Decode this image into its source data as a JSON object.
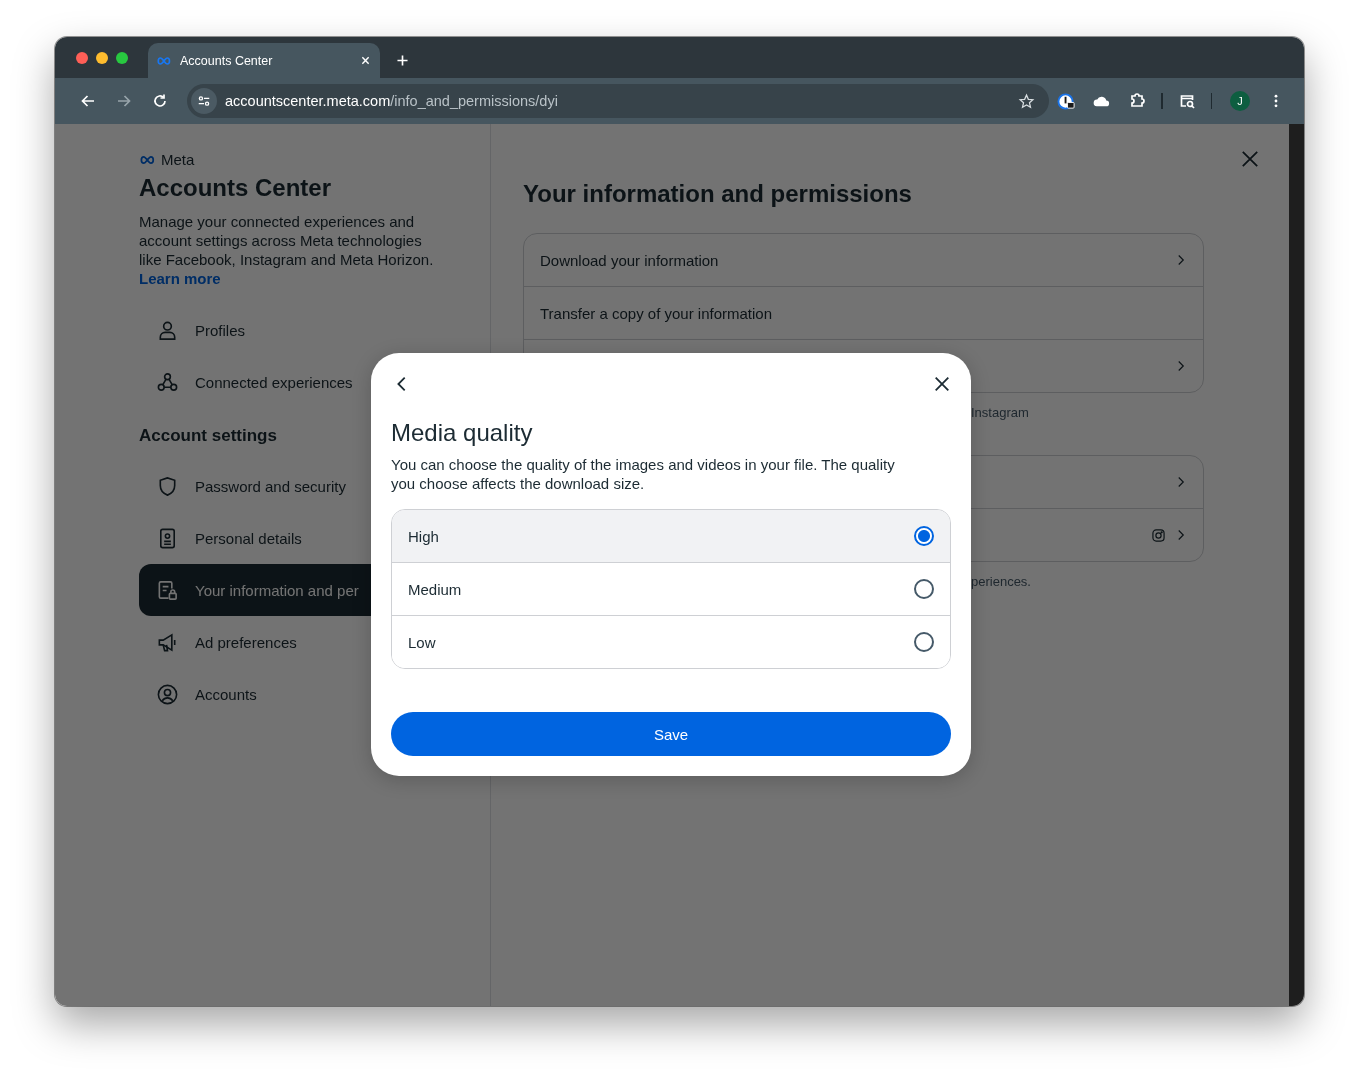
{
  "browser": {
    "tab_title": "Accounts Center",
    "url_host": "accountscenter.meta.com",
    "url_path": "/info_and_permissions/dyi",
    "profile_initial": "J"
  },
  "sidebar": {
    "brand": "Meta",
    "title": "Accounts Center",
    "description": "Manage your connected experiences and account settings across Meta technologies like Facebook, Instagram and Meta Horizon.",
    "learn_more": "Learn more",
    "items": [
      {
        "label": "Profiles",
        "kind": "person",
        "selected": false
      },
      {
        "label": "Connected experiences",
        "kind": "network",
        "selected": false
      }
    ],
    "section_title": "Account settings",
    "settings_items": [
      {
        "label": "Password and security",
        "kind": "shield",
        "selected": false
      },
      {
        "label": "Personal details",
        "kind": "id-card",
        "selected": false
      },
      {
        "label": "Your information and per",
        "kind": "document-lock",
        "selected": true
      },
      {
        "label": "Ad preferences",
        "kind": "megaphone",
        "selected": false
      },
      {
        "label": "Accounts",
        "kind": "person-circle",
        "selected": false
      }
    ]
  },
  "main": {
    "title": "Your information and permissions",
    "card_rows": [
      {
        "label": "Download your information",
        "chevron": true,
        "instagram_icon": false
      },
      {
        "label": "Transfer a copy of your information",
        "chevron": false,
        "instagram_icon": false
      },
      {
        "chevron": true,
        "instagram_icon": false
      }
    ],
    "note_1": "Instagram",
    "card_rows_2": [
      {
        "chevron": true,
        "instagram_icon": false
      },
      {
        "chevron": true,
        "instagram_icon": true
      }
    ],
    "note_2": "periences."
  },
  "dialog": {
    "title": "Media quality",
    "description": "You can choose the quality of the images and videos in your file. The quality you choose affects the download size.",
    "options": [
      {
        "label": "High",
        "selected": true
      },
      {
        "label": "Medium",
        "selected": false
      },
      {
        "label": "Low",
        "selected": false
      }
    ],
    "save": "Save"
  }
}
